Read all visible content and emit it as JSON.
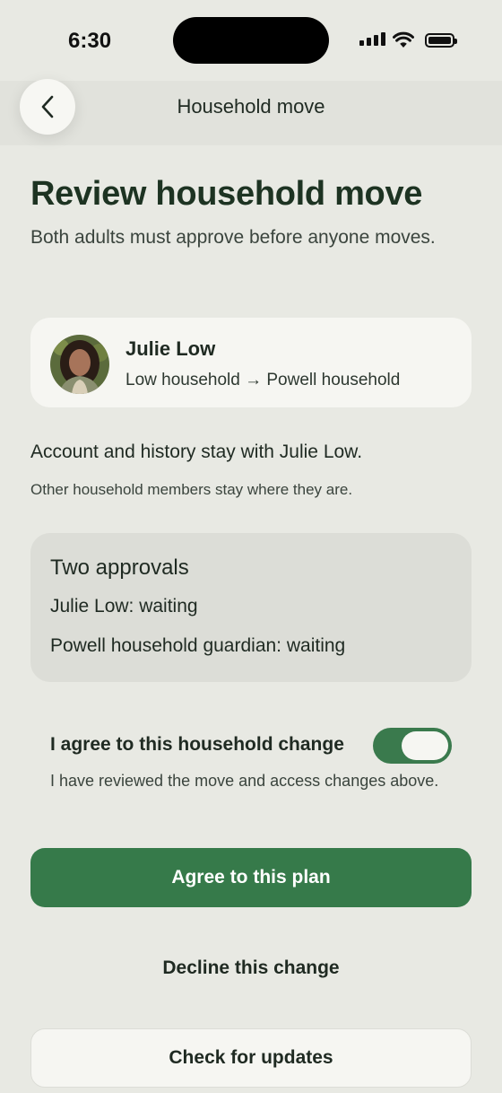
{
  "status_bar": {
    "time": "6:30"
  },
  "nav": {
    "title": "Household move",
    "back_icon": "chevron-left-icon"
  },
  "header": {
    "title": "Review household move",
    "subtitle": "Both adults must approve before anyone moves."
  },
  "person": {
    "name": "Julie Low",
    "move": "Low household → Powell household"
  },
  "info": {
    "account": "Account and history stay with Julie Low.",
    "others": "Other household members stay where they are."
  },
  "approvals": {
    "title": "Two approvals",
    "items": [
      "Julie Low: waiting",
      "Powell household guardian: waiting"
    ]
  },
  "agreement": {
    "label": "I agree to this household change",
    "help": "I have reviewed the move and access changes above.",
    "toggle_on": true
  },
  "actions": {
    "primary": "Agree to this plan",
    "decline": "Decline this change",
    "check": "Check for updates"
  },
  "colors": {
    "background": "#e8e9e3",
    "accent": "#367a4a",
    "title": "#1d3322"
  }
}
